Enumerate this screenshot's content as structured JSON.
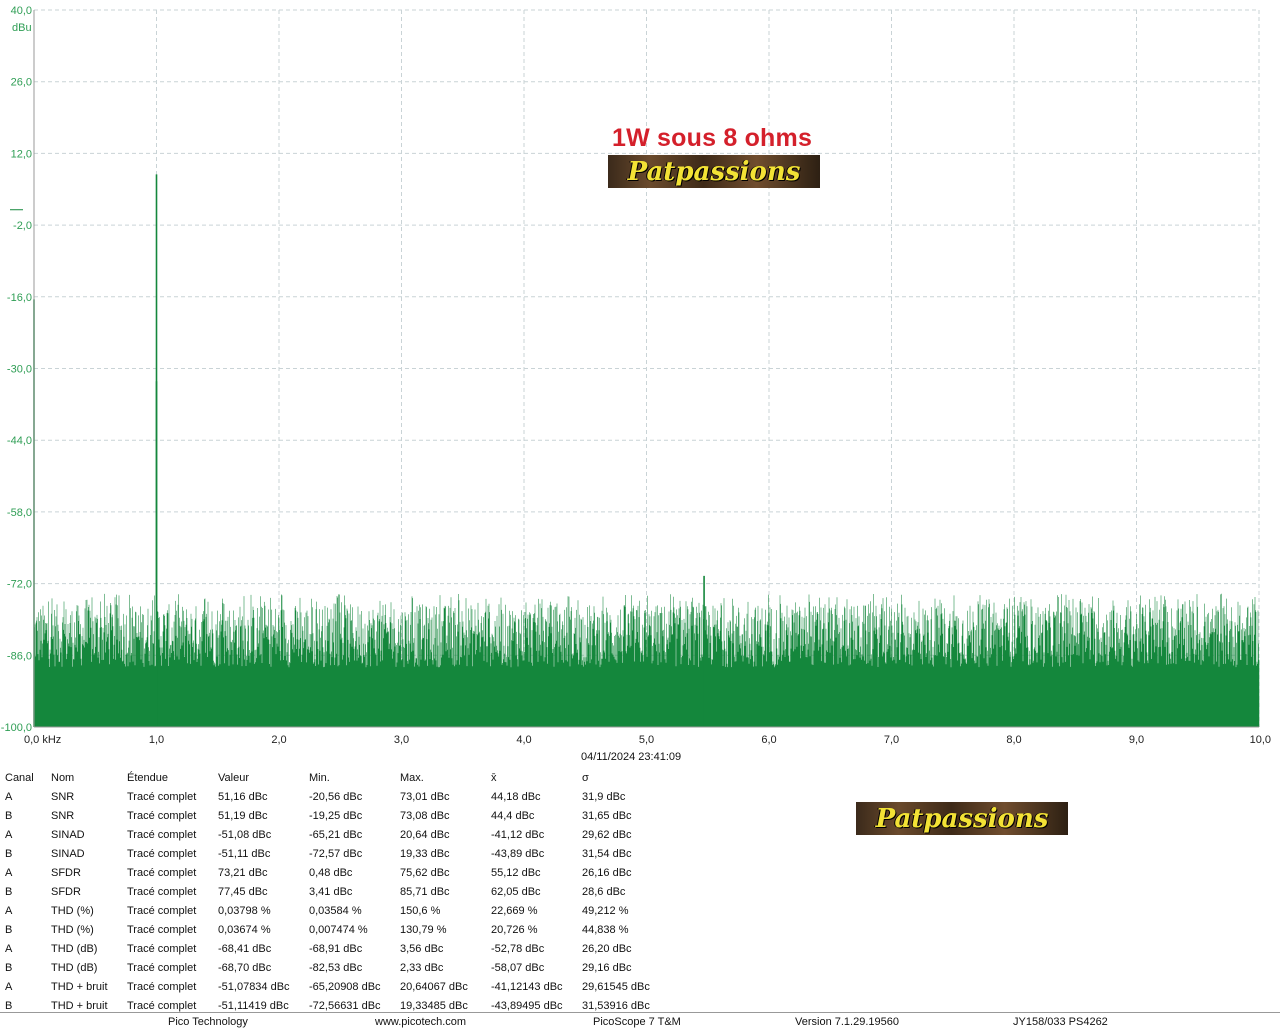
{
  "chart_data": {
    "type": "line",
    "xlabel": "",
    "ylabel": "dBu",
    "xlim": [
      0,
      10
    ],
    "ylim": [
      -100,
      40
    ],
    "x_ticks": [
      "0,0 kHz",
      "1,0",
      "2,0",
      "3,0",
      "4,0",
      "5,0",
      "6,0",
      "7,0",
      "8,0",
      "9,0",
      "10,0"
    ],
    "y_ticks": [
      "40,0",
      "26,0",
      "12,0",
      "-2,0",
      "-16,0",
      "-30,0",
      "-44,0",
      "-58,0",
      "-72,0",
      "-86,0",
      "-100,0"
    ],
    "y_tick_values": [
      40,
      26,
      12,
      -2,
      -16,
      -30,
      -44,
      -58,
      -72,
      -86,
      -100
    ],
    "grid": true,
    "noise_floor_range": [
      -95,
      -76
    ],
    "series": [
      {
        "color": "#14873c",
        "peaks": [
          {
            "x": 0.0,
            "y": -16.5
          },
          {
            "x": 1.0,
            "y": 7.9
          },
          {
            "x": 1.0,
            "y": -32.5
          },
          {
            "x": 5.47,
            "y": -70.5
          }
        ]
      }
    ],
    "annotations": [
      "1W sous 8 ohms",
      "Patpassions"
    ]
  },
  "colors": {
    "trace": "#14873c",
    "axis_label": "#2f9e55",
    "annotation": "#d4202b"
  },
  "timestamp": "04/11/2024 23:41:09",
  "measurements": {
    "headers": [
      "Canal",
      "Nom",
      "Étendue",
      "Valeur",
      "Min.",
      "Max.",
      "x̄",
      "σ"
    ],
    "rows": [
      [
        "A",
        "SNR",
        "Tracé complet",
        "51,16 dBc",
        "-20,56 dBc",
        "73,01 dBc",
        "44,18 dBc",
        "31,9 dBc"
      ],
      [
        "B",
        "SNR",
        "Tracé complet",
        "51,19 dBc",
        "-19,25 dBc",
        "73,08 dBc",
        "44,4 dBc",
        "31,65 dBc"
      ],
      [
        "A",
        "SINAD",
        "Tracé complet",
        "-51,08 dBc",
        "-65,21 dBc",
        "20,64 dBc",
        "-41,12 dBc",
        "29,62 dBc"
      ],
      [
        "B",
        "SINAD",
        "Tracé complet",
        "-51,11 dBc",
        "-72,57 dBc",
        "19,33 dBc",
        "-43,89 dBc",
        "31,54 dBc"
      ],
      [
        "A",
        "SFDR",
        "Tracé complet",
        "73,21 dBc",
        "0,48 dBc",
        "75,62 dBc",
        "55,12 dBc",
        "26,16 dBc"
      ],
      [
        "B",
        "SFDR",
        "Tracé complet",
        "77,45 dBc",
        "3,41 dBc",
        "85,71 dBc",
        "62,05 dBc",
        "28,6 dBc"
      ],
      [
        "A",
        "THD (%)",
        "Tracé complet",
        "0,03798 %",
        "0,03584 %",
        "150,6 %",
        "22,669 %",
        "49,212 %"
      ],
      [
        "B",
        "THD (%)",
        "Tracé complet",
        "0,03674 %",
        "0,007474 %",
        "130,79 %",
        "20,726 %",
        "44,838 %"
      ],
      [
        "A",
        "THD (dB)",
        "Tracé complet",
        "-68,41 dBc",
        "-68,91 dBc",
        "3,56 dBc",
        "-52,78 dBc",
        "26,20 dBc"
      ],
      [
        "B",
        "THD (dB)",
        "Tracé complet",
        "-68,70 dBc",
        "-82,53 dBc",
        "2,33 dBc",
        "-58,07 dBc",
        "29,16 dBc"
      ],
      [
        "A",
        "THD + bruit",
        "Tracé complet",
        "-51,07834 dBc",
        "-65,20908 dBc",
        "20,64067 dBc",
        "-41,12143 dBc",
        "29,61545 dBc"
      ],
      [
        "B",
        "THD + bruit",
        "Tracé complet",
        "-51,11419 dBc",
        "-72,56631 dBc",
        "19,33485 dBc",
        "-43,89495 dBc",
        "31,53916 dBc"
      ]
    ]
  },
  "footer": {
    "company": "Pico Technology",
    "website": "www.picotech.com",
    "product": "PicoScope 7 T&M",
    "version": "Version 7.1.29.19560",
    "device": "JY158/033 PS4262"
  }
}
